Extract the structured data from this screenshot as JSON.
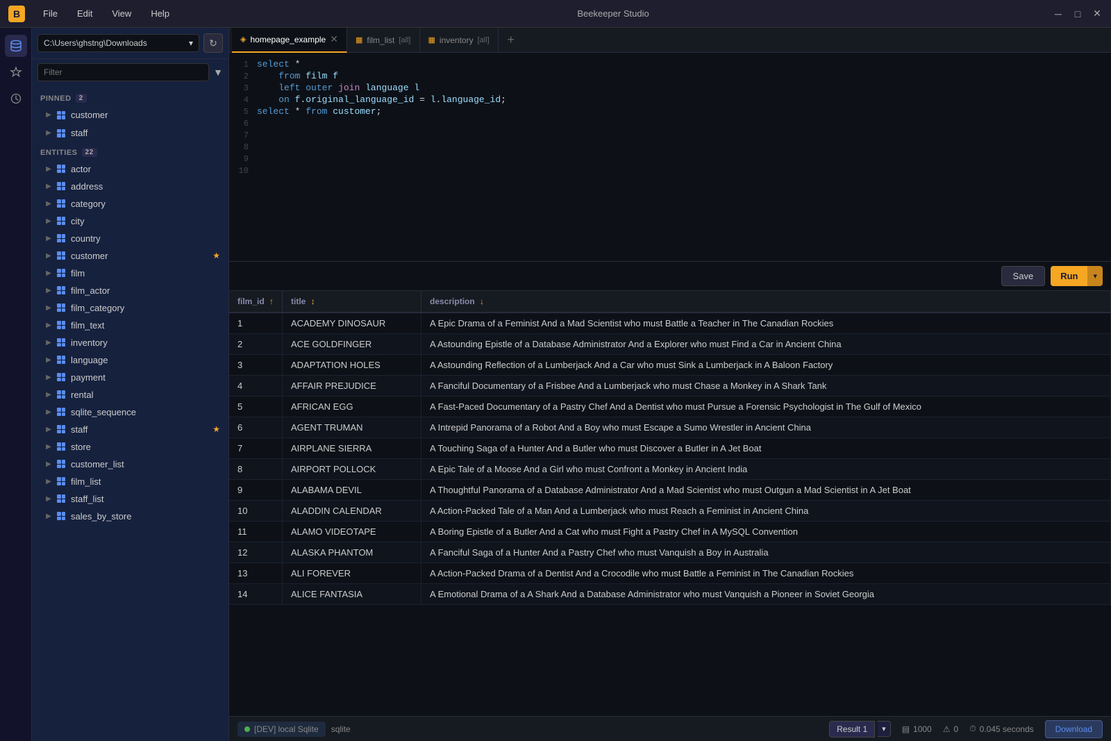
{
  "titleBar": {
    "appName": "Beekeeper Studio",
    "menuItems": [
      "File",
      "Edit",
      "View",
      "Help"
    ],
    "windowControls": [
      "minimize",
      "maximize",
      "close"
    ]
  },
  "sidebar": {
    "dbPath": "C:\\Users\\ghstng\\Downloads",
    "filterPlaceholder": "Filter",
    "pinned": {
      "label": "PINNED",
      "count": 2,
      "items": [
        {
          "name": "customer",
          "pinned": false,
          "removable": true
        },
        {
          "name": "staff",
          "pinned": false,
          "removable": true
        }
      ]
    },
    "entities": {
      "label": "ENTITIES",
      "count": 22,
      "items": [
        "actor",
        "address",
        "category",
        "city",
        "country",
        "customer",
        "film",
        "film_actor",
        "film_category",
        "film_text",
        "inventory",
        "language",
        "payment",
        "rental",
        "sqlite_sequence",
        "staff",
        "store",
        "customer_list",
        "film_list",
        "staff_list",
        "sales_by_store"
      ],
      "starred": [
        "customer",
        "staff"
      ]
    }
  },
  "tabs": [
    {
      "id": "homepage_example",
      "label": "homepage_example",
      "active": true,
      "closeable": true,
      "icon": "◈"
    },
    {
      "id": "film_list",
      "label": "film_list",
      "badge": "[all]",
      "active": false,
      "icon": "▦"
    },
    {
      "id": "inventory",
      "label": "inventory",
      "badge": "[all]",
      "active": false,
      "icon": "▦"
    }
  ],
  "codeEditor": {
    "lines": [
      {
        "num": 1,
        "text": "select *"
      },
      {
        "num": 2,
        "text": "    from film f"
      },
      {
        "num": 3,
        "text": "    left outer join language l"
      },
      {
        "num": 4,
        "text": "    on f.original_language_id = l.language_id;"
      },
      {
        "num": 5,
        "text": "select * from customer;"
      },
      {
        "num": 6,
        "text": ""
      },
      {
        "num": 7,
        "text": ""
      },
      {
        "num": 8,
        "text": ""
      },
      {
        "num": 9,
        "text": ""
      },
      {
        "num": 10,
        "text": ""
      }
    ]
  },
  "toolbar": {
    "saveLabel": "Save",
    "runLabel": "Run"
  },
  "resultsTable": {
    "columns": [
      {
        "id": "film_id",
        "label": "film_id",
        "sortable": true,
        "sortDir": "asc"
      },
      {
        "id": "title",
        "label": "title",
        "sortable": true
      },
      {
        "id": "description",
        "label": "description",
        "sortable": false,
        "sortDesc": true
      }
    ],
    "rows": [
      {
        "film_id": 1,
        "title": "ACADEMY DINOSAUR",
        "description": "A Epic Drama of a Feminist And a Mad Scientist who must Battle a Teacher in The Canadian Rockies"
      },
      {
        "film_id": 2,
        "title": "ACE GOLDFINGER",
        "description": "A Astounding Epistle of a Database Administrator And a Explorer who must Find a Car in Ancient China"
      },
      {
        "film_id": 3,
        "title": "ADAPTATION HOLES",
        "description": "A Astounding Reflection of a Lumberjack And a Car who must Sink a Lumberjack in A Baloon Factory"
      },
      {
        "film_id": 4,
        "title": "AFFAIR PREJUDICE",
        "description": "A Fanciful Documentary of a Frisbee And a Lumberjack who must Chase a Monkey in A Shark Tank"
      },
      {
        "film_id": 5,
        "title": "AFRICAN EGG",
        "description": "A Fast-Paced Documentary of a Pastry Chef And a Dentist who must Pursue a Forensic Psychologist in The Gulf of Mexico"
      },
      {
        "film_id": 6,
        "title": "AGENT TRUMAN",
        "description": "A Intrepid Panorama of a Robot And a Boy who must Escape a Sumo Wrestler in Ancient China"
      },
      {
        "film_id": 7,
        "title": "AIRPLANE SIERRA",
        "description": "A Touching Saga of a Hunter And a Butler who must Discover a Butler in A Jet Boat"
      },
      {
        "film_id": 8,
        "title": "AIRPORT POLLOCK",
        "description": "A Epic Tale of a Moose And a Girl who must Confront a Monkey in Ancient India"
      },
      {
        "film_id": 9,
        "title": "ALABAMA DEVIL",
        "description": "A Thoughtful Panorama of a Database Administrator And a Mad Scientist who must Outgun a Mad Scientist in A Jet Boat"
      },
      {
        "film_id": 10,
        "title": "ALADDIN CALENDAR",
        "description": "A Action-Packed Tale of a Man And a Lumberjack who must Reach a Feminist in Ancient China"
      },
      {
        "film_id": 11,
        "title": "ALAMO VIDEOTAPE",
        "description": "A Boring Epistle of a Butler And a Cat who must Fight a Pastry Chef in A MySQL Convention"
      },
      {
        "film_id": 12,
        "title": "ALASKA PHANTOM",
        "description": "A Fanciful Saga of a Hunter And a Pastry Chef who must Vanquish a Boy in Australia"
      },
      {
        "film_id": 13,
        "title": "ALI FOREVER",
        "description": "A Action-Packed Drama of a Dentist And a Crocodile who must Battle a Feminist in The Canadian Rockies"
      },
      {
        "film_id": 14,
        "title": "ALICE FANTASIA",
        "description": "A Emotional Drama of a A Shark And a Database Administrator who must Vanquish a Pioneer in Soviet Georgia"
      }
    ]
  },
  "statusBar": {
    "dbName": "[DEV] local Sqlite",
    "dbType": "sqlite",
    "resultTab": "Result 1",
    "rowCount": 1000,
    "errors": 0,
    "queryTime": "0.045 seconds",
    "downloadLabel": "Download"
  }
}
